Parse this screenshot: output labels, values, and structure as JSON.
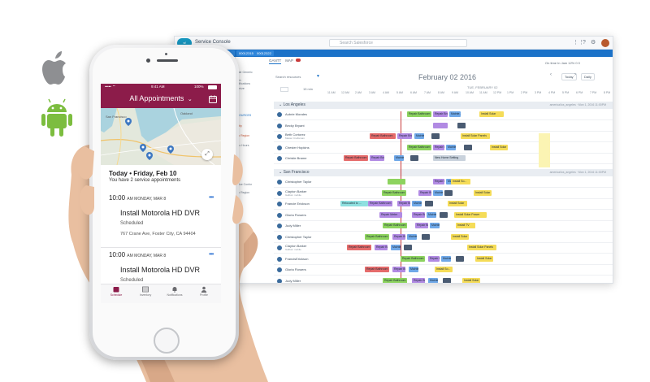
{
  "platform_icons": {
    "apple": "apple-icon",
    "android": "android-icon"
  },
  "desktop": {
    "app_name": "Service Console",
    "search_placeholder": "Search Salesforce",
    "nav_tabs": [
      "",
      "00012315",
      "00012322"
    ],
    "tabs": {
      "gantt": "GANTT",
      "map": "MAP"
    },
    "toolbar_right": "On time  In Jam  12%  0  0",
    "filter_label": "Search resources",
    "date": "February 02 2016",
    "subdate": "TUE, FEBRUARY 02",
    "today": "Today",
    "day_view": "Daily",
    "zoom": "15 min",
    "times": [
      "11 AM",
      "12 AM",
      "2 AM",
      "3 AM",
      "4 AM",
      "5 AM",
      "6 AM",
      "7 AM",
      "8 AM",
      "9 AM",
      "10 AM",
      "11 AM",
      "12 PM",
      "1 PM",
      "2 PM",
      "3 PM",
      "4 PM",
      "5 PM",
      "6 PM",
      "7 PM",
      "8 PM"
    ],
    "side_items": [
      "Create Generic Lst",
      "Match Qualifications",
      "Optimize",
      "RESOURCES",
      "Priority",
      "Work Region",
      "Radio Hours",
      "Optimize",
      "Service Confor",
      "Work Region"
    ],
    "groups": [
      {
        "name": "Los Angeles",
        "note": "america/los_angeles · Mon 1, 2016 11:00PM"
      },
      {
        "name": "San Francisco",
        "note": "america/los_angeles · Mon 1, 2016 11:00PM"
      }
    ],
    "la_resources": [
      "Aubrie Morales",
      "Becky Bryant",
      "Beth Cortorez",
      "Chester Hopkins",
      "Christie Brame"
    ],
    "la_sub": {
      "Beth Cortorez": "Master Craftsman"
    },
    "sf_resources": [
      "Christopher Taylor",
      "Clayton Barker",
      "Francie Erickson",
      "Gloria Flowers",
      "Judy Miller",
      "Christopher Taylor",
      "Clayton Barker",
      "FrancisErickson",
      "Gloria Flowers",
      "Judy Miller"
    ],
    "sf_sub": {
      "Clayton Barker": "Gallium mobile"
    },
    "bar_labels": {
      "repair_bathroom": "Repair Bathroom",
      "repair_bro": "Repair Bro...",
      "mainte": "Mainte...",
      "install_solar": "Install Solar",
      "repair_pipe": "Repair Pipe...",
      "install_solar_panel": "Install Solar Panels",
      "new_home_setup": "New Home Setting",
      "relocated": "Relocated to ...",
      "repair_meter": "Repair Meter",
      "install_tv": "Install TV",
      "install_so": "Install So...",
      "install_solar_power": "Install Solar Power"
    }
  },
  "mobile": {
    "status_time": "9:41 AM",
    "status_battery": "100%",
    "title": "All Appointments",
    "map_labels": {
      "sf": "San Francisco",
      "oakland": "Oakland"
    },
    "date_heading": "Today • Friday, Feb 10",
    "subheading": "You have 2 service appointments",
    "appointments": [
      {
        "time": "10:00",
        "ampm_date": "AM MONDAY, MAR 8",
        "job": "Install Motorola HD DVR",
        "status": "Scheduled",
        "address": "767 Crane Ave, Foster City, CA 94404"
      },
      {
        "time": "10:00",
        "ampm_date": "AM MONDAY, MAR 8",
        "job": "Install Motorola HD DVR",
        "status": "Scheduled",
        "address": ""
      }
    ],
    "tabs": [
      "Schedule",
      "Inventory",
      "Notifications",
      "Profile"
    ]
  },
  "colors": {
    "brand": "#8c1c4a",
    "nav": "#1b72c8",
    "green": "#8dd35f",
    "blue": "#6fa8e8",
    "purple": "#b18ae3",
    "yellow": "#f5dc58",
    "red": "#e56b6b",
    "teal": "#8ee0e0"
  }
}
